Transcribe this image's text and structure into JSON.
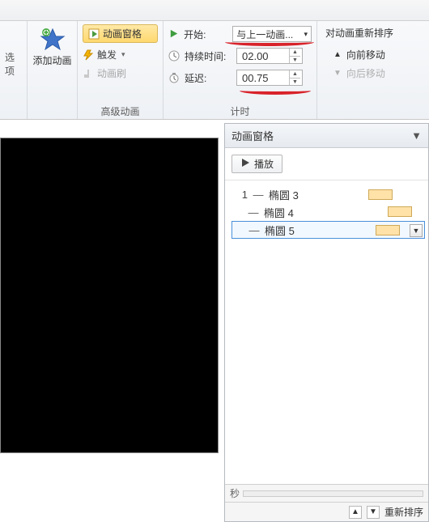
{
  "ribbon": {
    "options_label": "选项",
    "add_animation": "添加动画",
    "anim_pane_btn": "动画窗格",
    "trigger": "触发",
    "brush": "动画刷",
    "group_advanced": "高级动画",
    "timing": {
      "start_label": "开始:",
      "start_value": "与上一动画...",
      "duration_label": "持续时间:",
      "duration_value": "02.00",
      "delay_label": "延迟:",
      "delay_value": "00.75",
      "group_label": "计时"
    },
    "reorder": {
      "title": "对动画重新排序",
      "up": "向前移动",
      "down": "向后移动"
    }
  },
  "pane": {
    "title": "动画窗格",
    "play": "播放",
    "items": [
      {
        "num": "1",
        "name": "椭圆 3"
      },
      {
        "num": "",
        "name": "椭圆 4"
      },
      {
        "num": "",
        "name": "椭圆 5"
      }
    ],
    "seconds_label": "秒",
    "reorder_label": "重新排序"
  }
}
